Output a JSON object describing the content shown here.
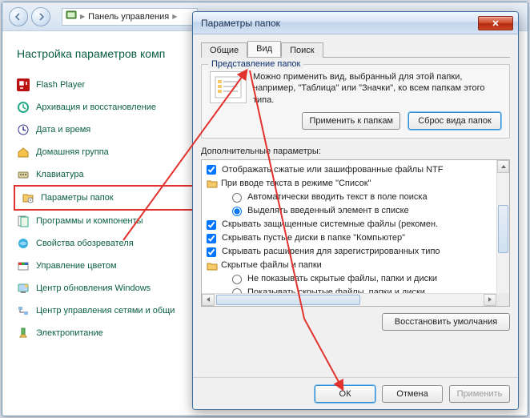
{
  "header": {
    "breadcrumb_label": "Панель управления"
  },
  "page": {
    "title": "Настройка параметров комп"
  },
  "cp_items": [
    {
      "label": "Flash Player"
    },
    {
      "label": "Архивация и восстановление"
    },
    {
      "label": "Дата и время"
    },
    {
      "label": "Домашняя группа"
    },
    {
      "label": "Клавиатура"
    },
    {
      "label": "Параметры папок"
    },
    {
      "label": "Программы и компоненты"
    },
    {
      "label": "Свойства обозревателя"
    },
    {
      "label": "Управление цветом"
    },
    {
      "label": "Центр обновления Windows"
    },
    {
      "label": "Центр управления сетями и общи"
    },
    {
      "label": "Электропитание"
    }
  ],
  "dialog": {
    "title": "Параметры папок",
    "tabs": {
      "general": "Общие",
      "view": "Вид",
      "search": "Поиск"
    },
    "group_title": "Представление папок",
    "folder_desc": "Можно применить вид, выбранный для этой папки, например, \"Таблица\" или \"Значки\", ко всем папкам этого типа.",
    "apply_to_folders": "Применить к папкам",
    "reset_folders": "Сброс вида папок",
    "adv_label": "Дополнительные параметры:",
    "tree": [
      {
        "type": "check",
        "checked": true,
        "text": "Отображать сжатые или зашифрованные файлы NTF",
        "indent": 0
      },
      {
        "type": "folder",
        "text": "При вводе текста в режиме \"Список\"",
        "indent": 0
      },
      {
        "type": "radio",
        "checked": false,
        "text": "Автоматически вводить текст в поле поиска",
        "indent": 2
      },
      {
        "type": "radio",
        "checked": true,
        "text": "Выделять введенный элемент в списке",
        "indent": 2
      },
      {
        "type": "check",
        "checked": true,
        "text": "Скрывать защищенные системные файлы (рекомен.",
        "indent": 0
      },
      {
        "type": "check",
        "checked": true,
        "text": "Скрывать пустые диски в папке \"Компьютер\"",
        "indent": 0
      },
      {
        "type": "check",
        "checked": true,
        "text": "Скрывать расширения для зарегистрированных типо",
        "indent": 0
      },
      {
        "type": "folder",
        "text": "Скрытые файлы и папки",
        "indent": 0
      },
      {
        "type": "radio",
        "checked": false,
        "text": "Не показывать скрытые файлы, папки и диски",
        "indent": 2
      },
      {
        "type": "radio",
        "checked": false,
        "text": "Показывать скрытые файлы, папки и диски",
        "indent": 2
      }
    ],
    "restore_defaults": "Восстановить умолчания",
    "footer": {
      "ok": "ОК",
      "cancel": "Отмена",
      "apply": "Применить"
    }
  }
}
